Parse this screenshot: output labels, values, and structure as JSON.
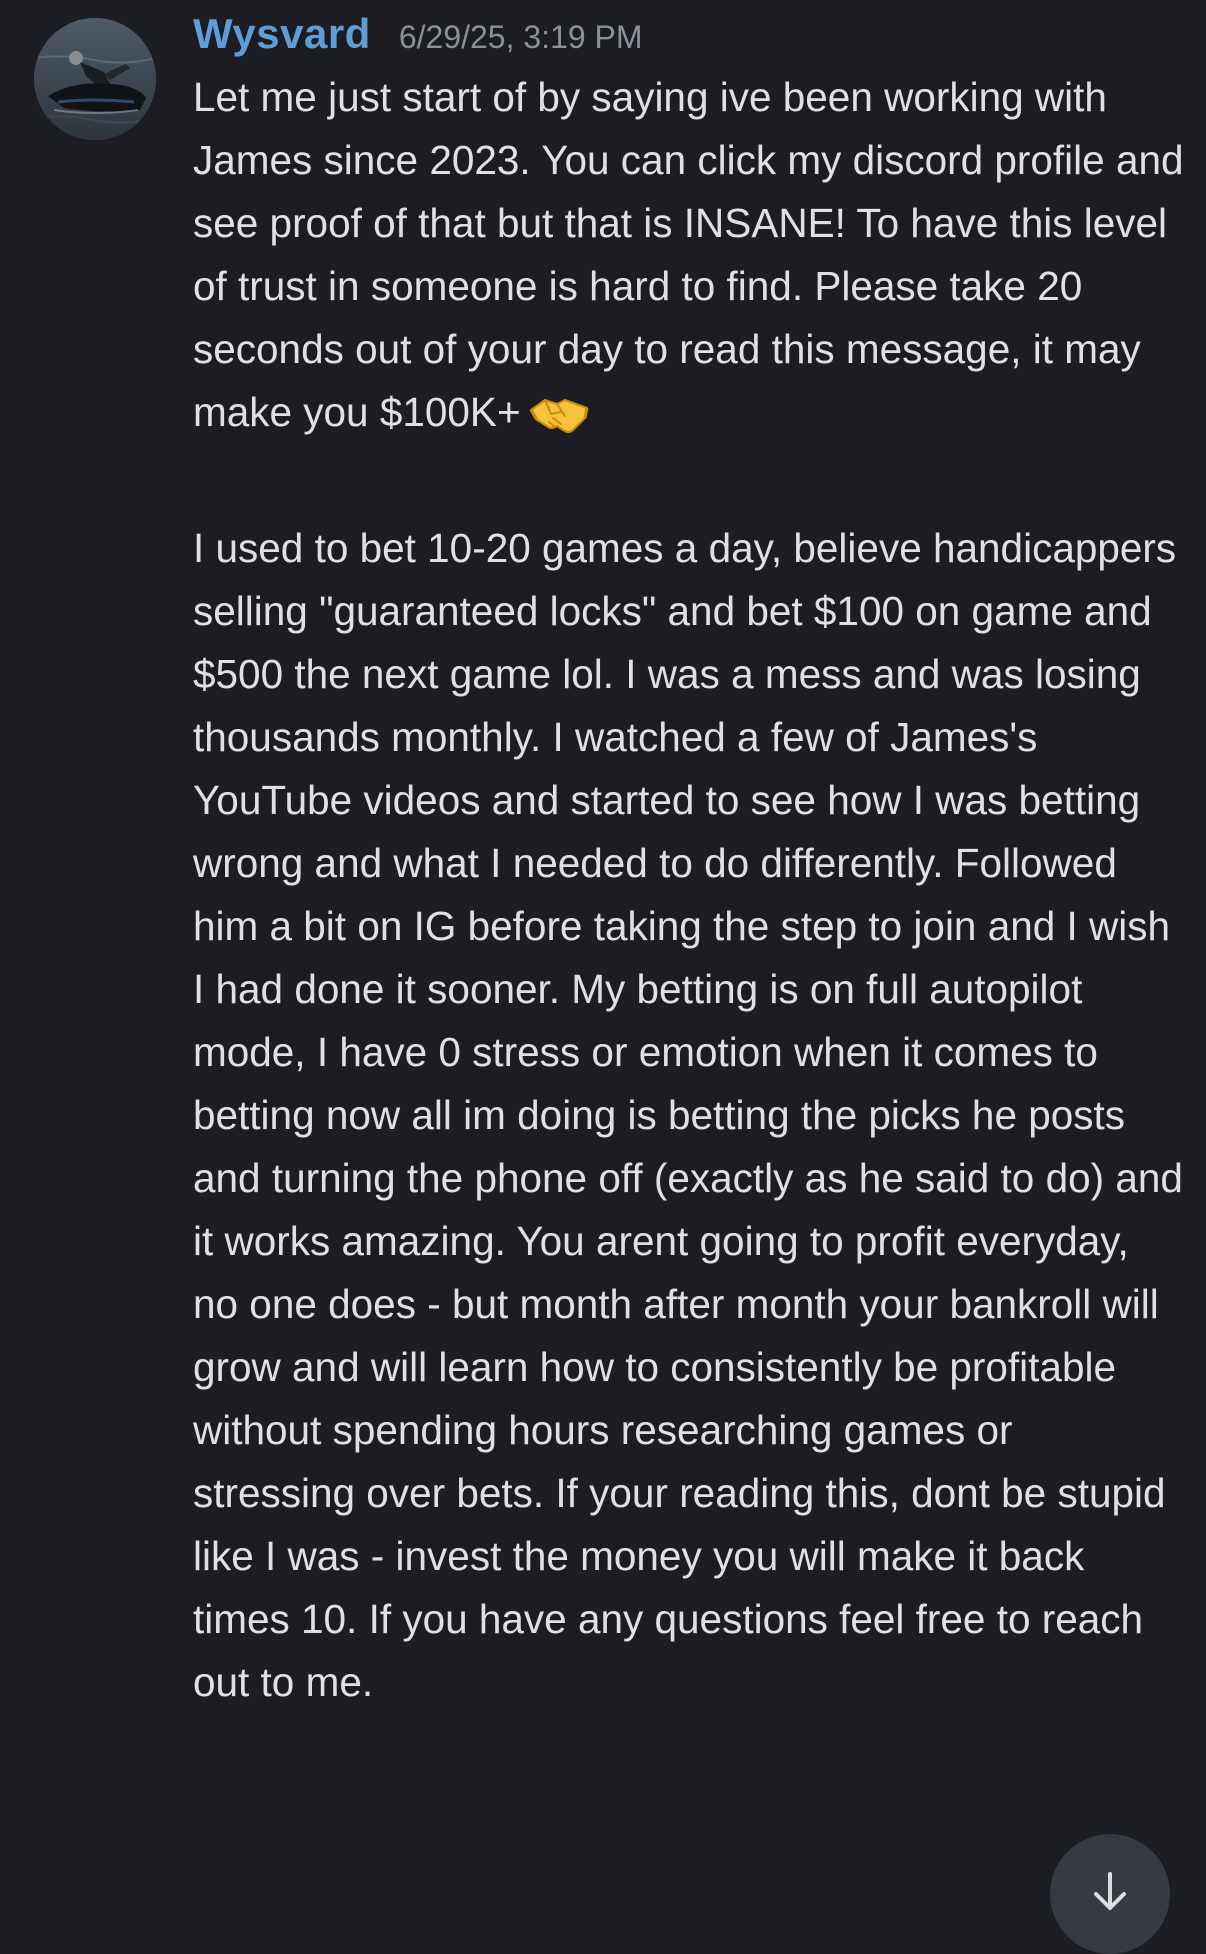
{
  "message": {
    "username": "Wysvard",
    "timestamp": "6/29/25, 3:19 PM",
    "avatar_icon": "jetski-rider-photo",
    "paragraphs": [
      "Let me just start of by saying ive been working with James since 2023. You can click my discord profile and see proof of that but that is INSANE! To have this level of trust in someone is hard to find. Please take 20 seconds out of your day to read this message, it may make you $100K+",
      "I used to bet 10-20 games a day, believe handicappers selling \"guaranteed locks\" and bet $100 on game and $500 the next game lol. I was a mess and was losing thousands monthly. I watched a few of James's YouTube videos and started to see how I was betting wrong and what I needed to do differently. Followed him a bit on IG before taking the step to join and I wish I had done it sooner. My betting is on full autopilot mode, I have 0 stress or emotion when it comes to betting now all im doing is betting the picks he posts and turning the phone off (exactly as he said to do) and it works amazing. You arent going to profit everyday, no one does - but month after month your bankroll will grow and will learn how to consistently be profitable without spending hours researching games or stressing over bets. If your reading this, dont be stupid like I was - invest the money you will make it back times 10. If you have any questions feel free to reach out to me."
    ],
    "emoji": "handshake-emoji"
  },
  "jump_button": {
    "icon": "arrow-down-icon"
  },
  "colors": {
    "background": "#1c1d22",
    "username": "#5f9dd8",
    "text": "#dfe0e4",
    "timestamp": "#8e9097",
    "button": "#383a42"
  }
}
